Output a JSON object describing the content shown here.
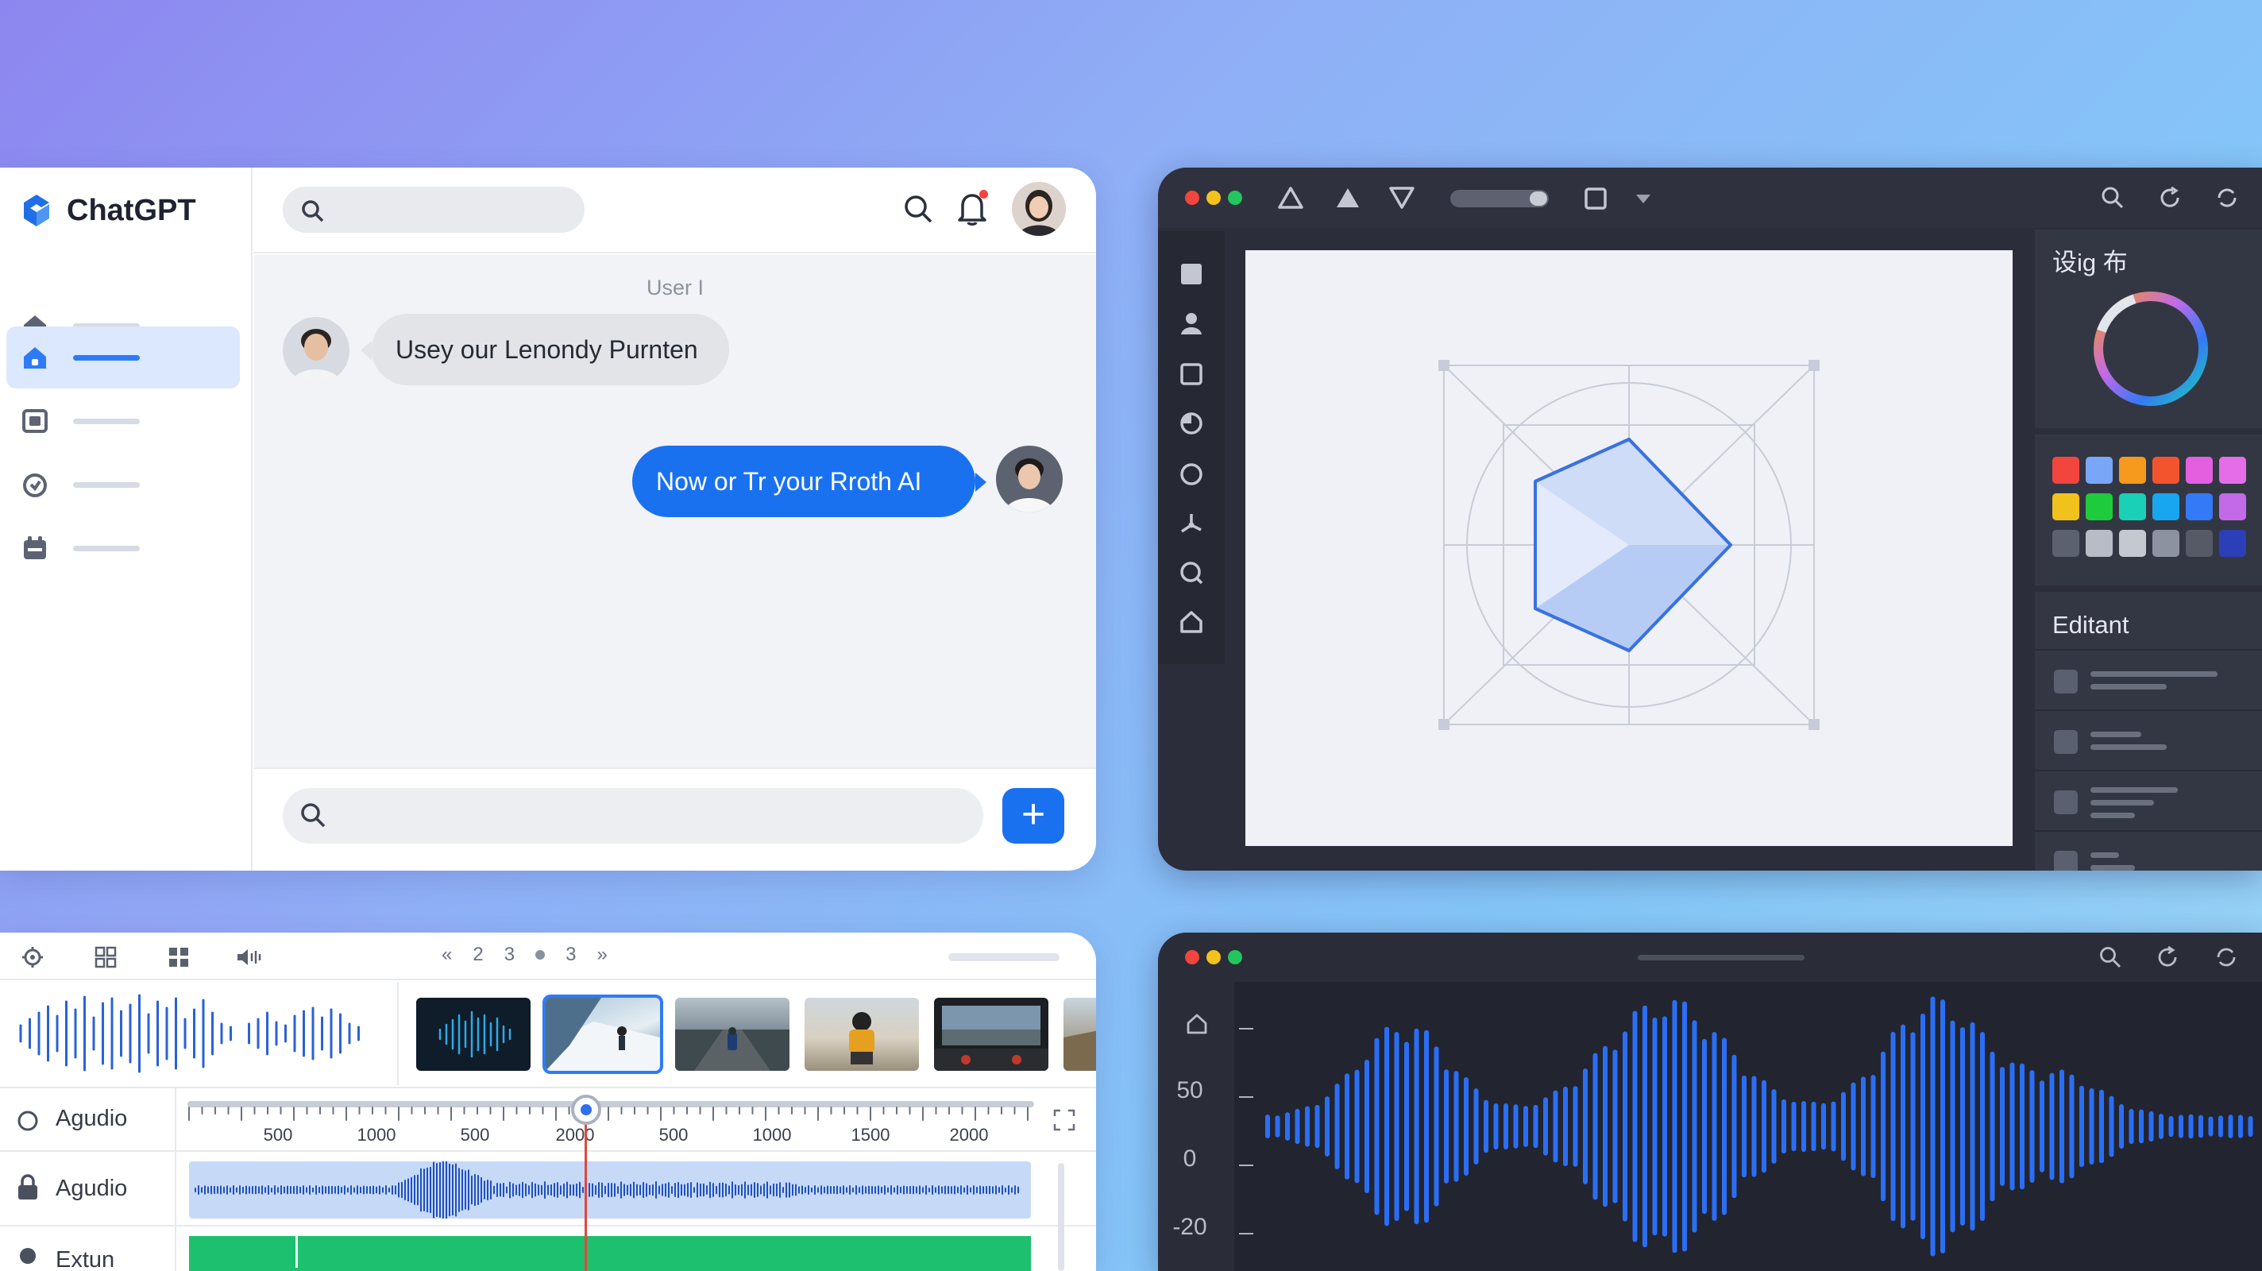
{
  "chat": {
    "app_name": "ChatGPT",
    "user_label": "User I",
    "incoming_message": "Usey our Lenondy Purnten",
    "outgoing_message": "Now or Tr your Rroth AI",
    "send_label": "+",
    "nav_items": [
      "home-icon",
      "home-filled-icon",
      "window-icon",
      "shield-icon",
      "calendar-icon"
    ],
    "accent": "#1a71f0"
  },
  "design": {
    "colors_title": "设ig 布",
    "layers_title": "Editant",
    "tool_icons": [
      "square-icon",
      "person-icon",
      "square-outline-icon",
      "circle-half-icon",
      "circle-icon",
      "node-icon",
      "search-circle-icon",
      "home-outline-icon"
    ],
    "swatches": [
      "#f2453d",
      "#7aa6f8",
      "#f59a1c",
      "#f3542e",
      "#e35fe0",
      "#e56ee8",
      "#f2c21c",
      "#1ecb3c",
      "#1ad0b6",
      "#18a6f0",
      "#3479f6",
      "#c26ae8",
      "#5c6170",
      "#b7bcc6",
      "#c4c8d0",
      "#8d92a0",
      "#555a66",
      "#2b3fb8"
    ]
  },
  "timeline": {
    "pager": [
      "2",
      "3",
      "3"
    ],
    "track1_label": "Agudio",
    "track2_label": "Agudio",
    "track3_label": "Extun",
    "ruler_ticks": [
      "500",
      "1000",
      "500",
      "2000",
      "500",
      "1000",
      "1500",
      "2000"
    ],
    "thumbnails": [
      "waveform-thumb",
      "skier-thumb",
      "road-cyclist-thumb",
      "motorcyclist-thumb",
      "dashboard-thumb",
      "landscape-thumb"
    ]
  },
  "waveform": {
    "y_labels": [
      "50",
      "0",
      "-20"
    ]
  }
}
